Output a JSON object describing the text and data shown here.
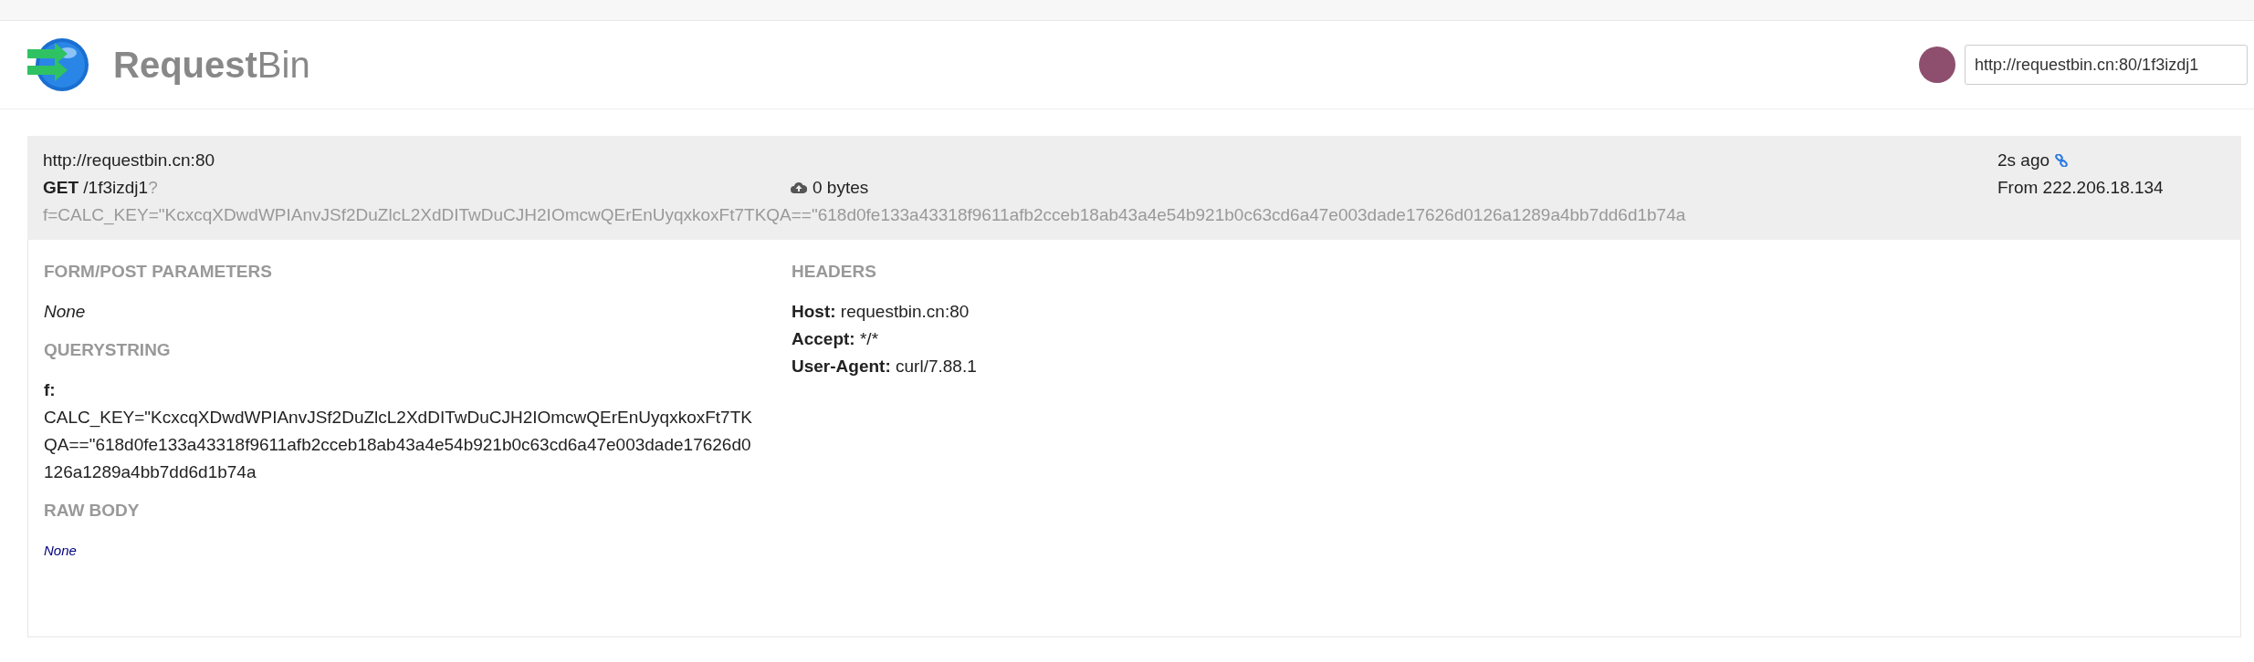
{
  "brand": {
    "bold": "Request",
    "light": "Bin"
  },
  "bin_url": {
    "value": "http://requestbin.cn:80/1f3izdj1"
  },
  "request": {
    "host": "http://requestbin.cn:80",
    "method": "GET",
    "path": "/1f3izdj1",
    "query_mark": "?",
    "query": "f=CALC_KEY=\"KcxcqXDwdWPIAnvJSf2DuZlcL2XdDITwDuCJH2IOmcwQErEnUyqxkoxFt7TKQA==\"618d0fe133a43318f9611afb2cceb18ab43a4e54b921b0c63cd6a47e003dade17626d0126a1289a4bb7dd6d1b74a",
    "size": "0 bytes",
    "time": "2s ago",
    "from": "From 222.206.18.134"
  },
  "form_post": {
    "title": "FORM/POST PARAMETERS",
    "value": "None"
  },
  "querystring": {
    "title": "QUERYSTRING",
    "params": [
      {
        "key": "f:",
        "value": "CALC_KEY=\"KcxcqXDwdWPIAnvJSf2DuZlcL2XdDITwDuCJH2IOmcwQErEnUyqxkoxFt7TKQA==\"618d0fe133a43318f9611afb2cceb18ab43a4e54b921b0c63cd6a47e003dade17626d0126a1289a4bb7dd6d1b74a"
      }
    ]
  },
  "raw_body": {
    "title": "RAW BODY",
    "value": "None"
  },
  "headers": {
    "title": "HEADERS",
    "items": [
      {
        "name": "Host:",
        "value": "requestbin.cn:80"
      },
      {
        "name": "Accept:",
        "value": "*/*"
      },
      {
        "name": "User-Agent:",
        "value": "curl/7.88.1"
      }
    ]
  }
}
